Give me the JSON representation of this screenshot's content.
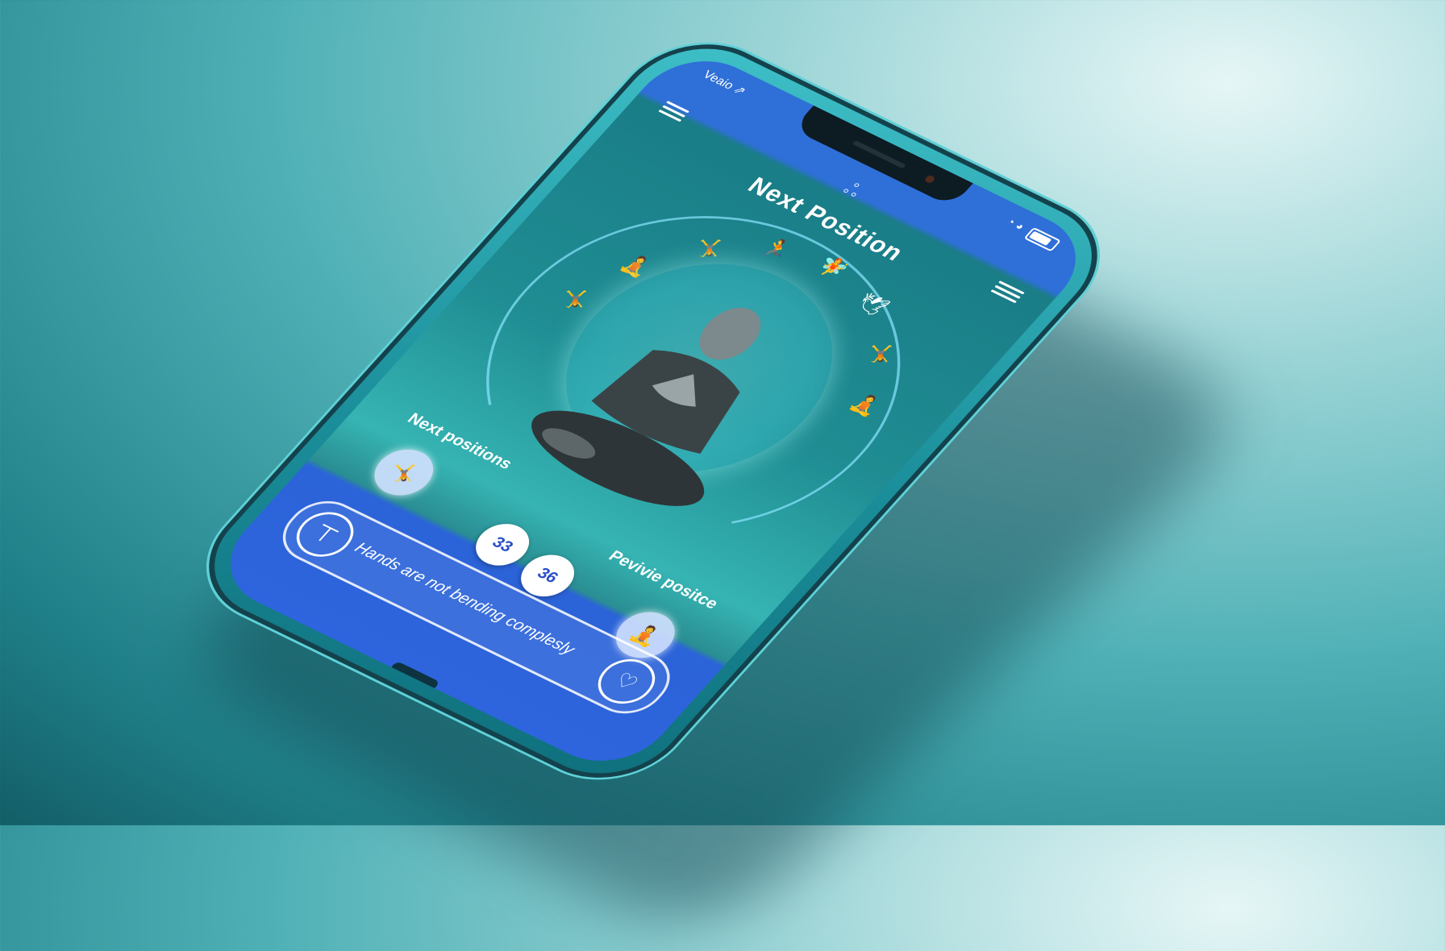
{
  "status": {
    "carrier": "Veaio ⇗"
  },
  "header": {
    "title": "Next Position"
  },
  "sections": {
    "next_label": "Next positions",
    "prev_label": "Pevivie positce"
  },
  "counters": [
    {
      "value": "33"
    },
    {
      "value": "36"
    }
  ],
  "feedback": {
    "message": "Hands are not bending complesly"
  },
  "icons": {
    "status_logo": "arrow-logo-icon",
    "menu_left": "menu-icon",
    "menu_right": "hamburger-icon",
    "center": "app-logo-icon",
    "next_pose": "yoga-pose-icon",
    "prev_pose": "yoga-pose-icon",
    "feedback": "posture-icon",
    "like": "heart-icon"
  },
  "colors": {
    "accent": "#2f6fd8",
    "teal": "#1f8d93",
    "background": "#4fb1b6"
  }
}
